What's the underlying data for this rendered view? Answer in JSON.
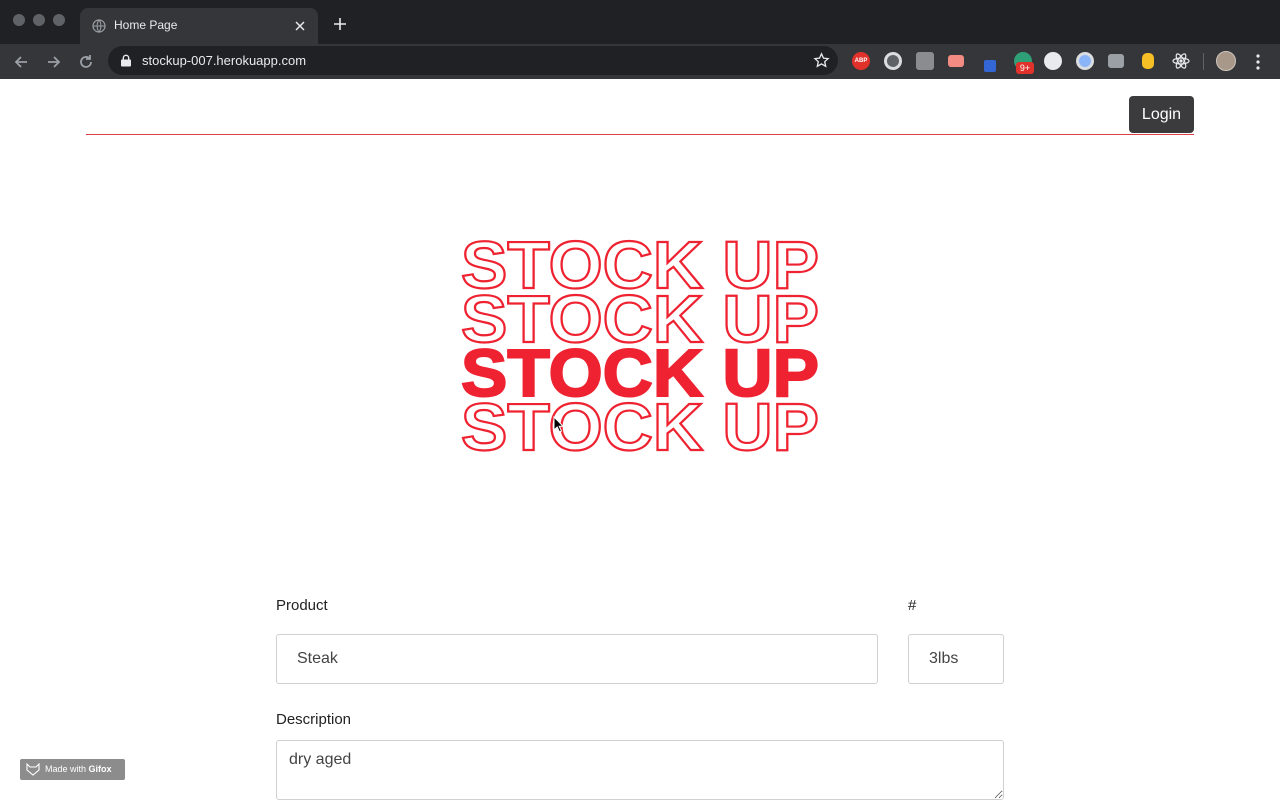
{
  "browser": {
    "tab_title": "Home Page",
    "url": "stockup-007.herokuapp.com",
    "extension_badge": "9+",
    "abp_label": "ABP"
  },
  "header": {
    "login_label": "Login",
    "rule_color": "#d94048"
  },
  "logo": {
    "lines": [
      "STOCK UP",
      "STOCK UP",
      "STOCK UP",
      "STOCK UP"
    ],
    "color": "#ee2230",
    "filled_line_index": 2
  },
  "form": {
    "product_label": "Product",
    "product_value": "Steak",
    "quantity_label": "#",
    "quantity_value": "3lbs",
    "description_label": "Description",
    "description_value": "dry aged"
  },
  "watermark": {
    "prefix": "Made with",
    "brand": "Gifox"
  },
  "icons": [
    "globe-icon",
    "close-icon",
    "plus-icon",
    "back-arrow-icon",
    "forward-arrow-icon",
    "reload-icon",
    "lock-icon",
    "star-icon",
    "menu-icon",
    "cursor-icon"
  ]
}
